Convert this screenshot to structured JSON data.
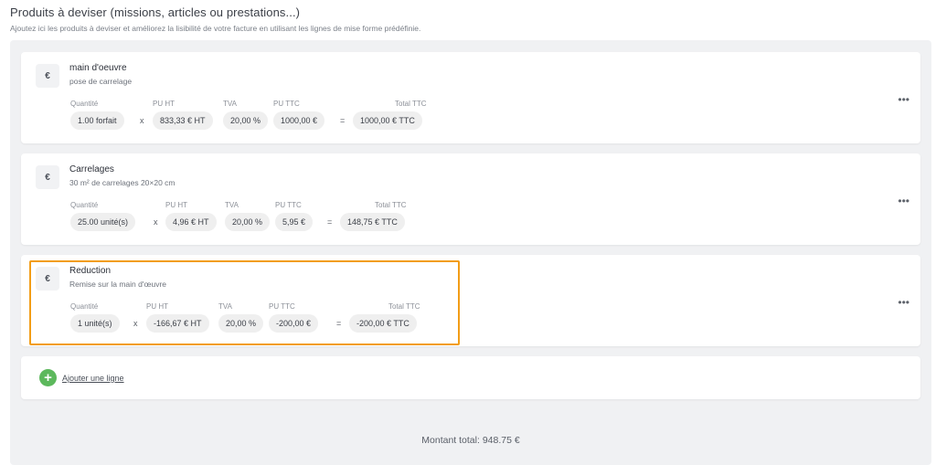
{
  "header": {
    "title": "Produits à deviser (missions, articles ou prestations...)",
    "subtitle": "Ajoutez ici les produits à deviser et améliorez la lisibilité de votre facture en utilisant les lignes de mise forme prédéfinie."
  },
  "columns": {
    "qty": "Quantité",
    "pu_ht": "PU HT",
    "tva": "TVA",
    "pu_ttc": "PU TTC",
    "total_ttc": "Total TTC"
  },
  "operators": {
    "times": "x",
    "equals": "="
  },
  "icon_symbol": "€",
  "more_symbol": "•••",
  "lines": [
    {
      "name": "main d'oeuvre",
      "description": "pose de carrelage",
      "qty": "1.00 forfait",
      "pu_ht": "833,33 € HT",
      "tva": "20,00 %",
      "pu_ttc": "1000,00 €",
      "total_ttc": "1000,00 € TTC"
    },
    {
      "name": "Carrelages",
      "description": "30 m² de carrelages 20×20 cm",
      "qty": "25.00 unité(s)",
      "pu_ht": "4,96 € HT",
      "tva": "20,00 %",
      "pu_ttc": "5,95 €",
      "total_ttc": "148,75 € TTC"
    },
    {
      "name": "Reduction",
      "description": "Remise sur la main d'œuvre",
      "qty": "1 unité(s)",
      "pu_ht": "-166,67 € HT",
      "tva": "20,00 %",
      "pu_ttc": "-200,00 €",
      "total_ttc": "-200,00 € TTC"
    }
  ],
  "add_line": {
    "symbol": "+",
    "label": "Ajouter une ligne"
  },
  "total": "Montant total: 948.75 €",
  "colors": {
    "highlight": "#f29d17",
    "add_button": "#5cb85c",
    "panel_bg": "#f0f1f3"
  }
}
